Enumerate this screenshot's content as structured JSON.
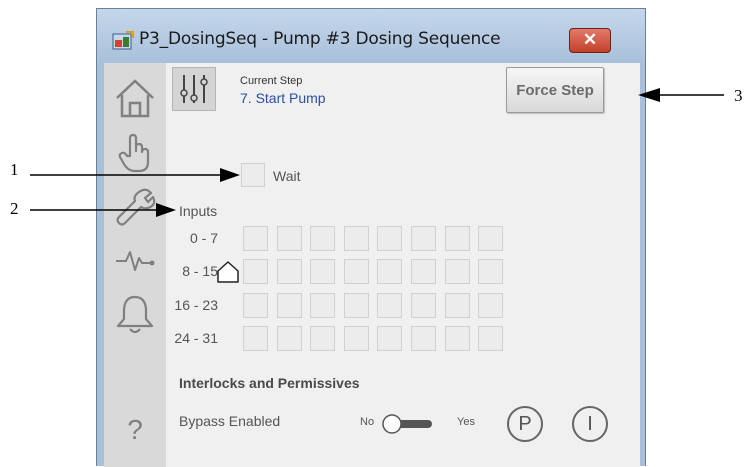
{
  "window": {
    "title": "P3_DosingSeq - Pump #3 Dosing Sequence",
    "close_glyph": "✕"
  },
  "sidebar": {
    "items": [
      {
        "icon": "home-icon"
      },
      {
        "icon": "hand-icon"
      },
      {
        "icon": "wrench-icon"
      },
      {
        "icon": "trend-icon"
      },
      {
        "icon": "bell-icon"
      },
      {
        "icon": "help-icon",
        "glyph": "?"
      }
    ]
  },
  "step": {
    "caption": "Current Step",
    "value": "7. Start Pump",
    "force_button": "Force Step"
  },
  "wait": {
    "label": "Wait"
  },
  "inputs": {
    "label": "Inputs",
    "rows": [
      {
        "label": "0 - 7"
      },
      {
        "label": "8 - 15"
      },
      {
        "label": "16 - 23"
      },
      {
        "label": "24 - 31"
      }
    ]
  },
  "interlocks": {
    "title": "Interlocks and Permissives",
    "bypass_label": "Bypass Enabled",
    "no_label": "No",
    "yes_label": "Yes",
    "p_button": "P",
    "i_button": "I"
  },
  "callouts": {
    "one": "1",
    "two": "2",
    "three": "3"
  },
  "colors": {
    "step_value": "#2b4fa3",
    "titlebar": "#a9c0da",
    "close_button": "#c94a33"
  }
}
